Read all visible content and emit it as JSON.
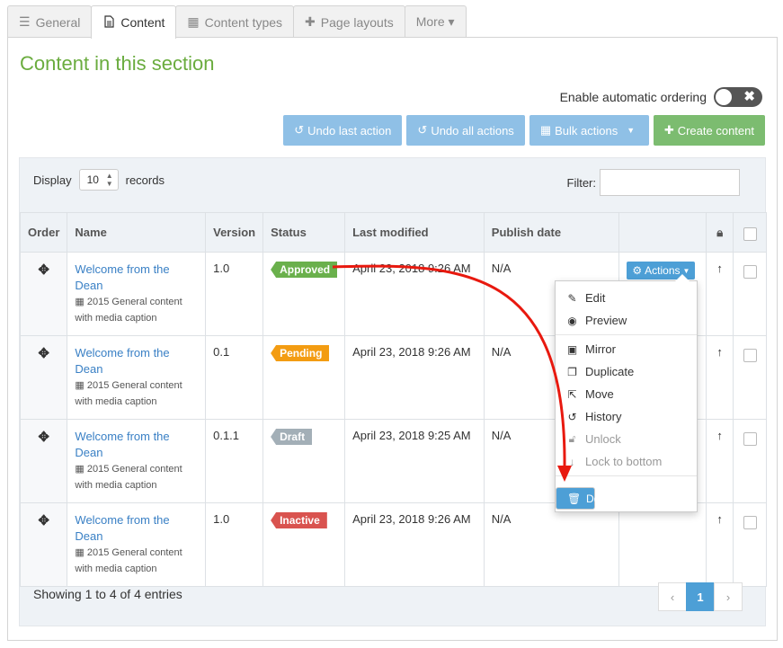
{
  "tabs": [
    {
      "label": "General",
      "icon": "sliders-icon"
    },
    {
      "label": "Content",
      "icon": "document-icon"
    },
    {
      "label": "Content types",
      "icon": "cubes-icon"
    },
    {
      "label": "Page layouts",
      "icon": "puzzle-icon"
    },
    {
      "label": "More ▾",
      "icon": ""
    }
  ],
  "section_title": "Content in this section",
  "ordering": {
    "label": "Enable automatic ordering",
    "toggle_mark": "✖"
  },
  "actions_bar": {
    "undo_last": "Undo last action",
    "undo_all": "Undo all actions",
    "bulk": "Bulk actions",
    "create": "Create content"
  },
  "display": {
    "prefix": "Display",
    "value": "10",
    "suffix": "records"
  },
  "filter_label": "Filter:",
  "columns": {
    "order": "Order",
    "name": "Name",
    "version": "Version",
    "status": "Status",
    "modified": "Last modified",
    "publish": "Publish date"
  },
  "rows": [
    {
      "name": "Welcome from the Dean",
      "type": "2015 General content with media caption",
      "version": "1.0",
      "status": "Approved",
      "status_color": "#6ab04c",
      "modified": "April 23, 2018 9:26 AM",
      "publish": "N/A"
    },
    {
      "name": "Welcome from the Dean",
      "type": "2015 General content with media caption",
      "version": "0.1",
      "status": "Pending",
      "status_color": "#f39c12",
      "modified": "April 23, 2018 9:26 AM",
      "publish": "N/A"
    },
    {
      "name": "Welcome from the Dean",
      "type": "2015 General content with media caption",
      "version": "0.1.1",
      "status": "Draft",
      "status_color": "#a3afb7",
      "modified": "April 23, 2018 9:25 AM",
      "publish": "N/A"
    },
    {
      "name": "Welcome from the Dean",
      "type": "2015 General content with media caption",
      "version": "1.0",
      "status": "Inactive",
      "status_color": "#d9534f",
      "modified": "April 23, 2018 9:26 AM",
      "publish": "N/A"
    }
  ],
  "row_actions_label": "Actions",
  "menu": {
    "edit": "Edit",
    "preview": "Preview",
    "mirror": "Mirror",
    "duplicate": "Duplicate",
    "move": "Move",
    "history": "History",
    "unlock": "Unlock",
    "lock_bottom": "Lock to bottom",
    "delete": "Delete"
  },
  "footer": {
    "showing": "Showing 1 to 4 of 4 entries",
    "page": "1",
    "prev": "‹",
    "next": "›"
  },
  "colors": {
    "accent": "#4d9fd6",
    "title": "#6aac3e",
    "annotation": "#e8190f"
  }
}
